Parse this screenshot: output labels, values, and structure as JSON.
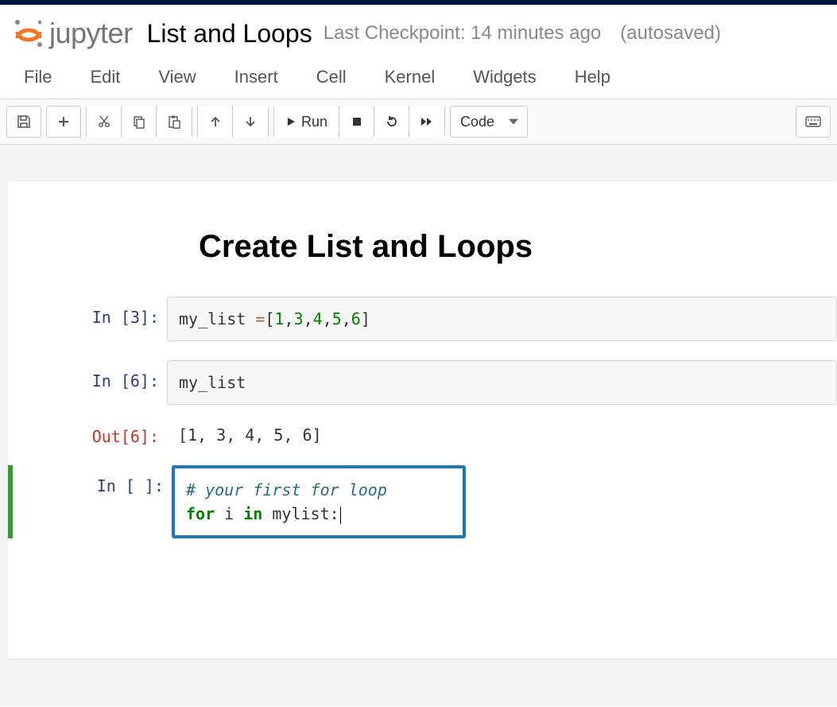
{
  "header": {
    "logo_word": "jupyter",
    "notebook_title": "List and Loops",
    "checkpoint": "Last Checkpoint: 14 minutes ago",
    "autosave": "(autosaved)"
  },
  "menubar": [
    "File",
    "Edit",
    "View",
    "Insert",
    "Cell",
    "Kernel",
    "Widgets",
    "Help"
  ],
  "toolbar": {
    "run_label": "Run",
    "cell_type": "Code"
  },
  "notebook": {
    "heading": "Create List and Loops",
    "cells": [
      {
        "prompt_in": "In [3]:",
        "code_plain": "my_list =[1,3,4,5,6]"
      },
      {
        "prompt_in": "In [6]:",
        "code_plain": "my_list",
        "prompt_out": "Out[6]:",
        "output": "[1, 3, 4, 5, 6]"
      },
      {
        "prompt_in": "In [ ]:",
        "code_line1_comment": "# your first for loop",
        "code_line2_kw1": "for",
        "code_line2_mid": " i ",
        "code_line2_kw2": "in",
        "code_line2_rest": " mylist:"
      }
    ]
  }
}
